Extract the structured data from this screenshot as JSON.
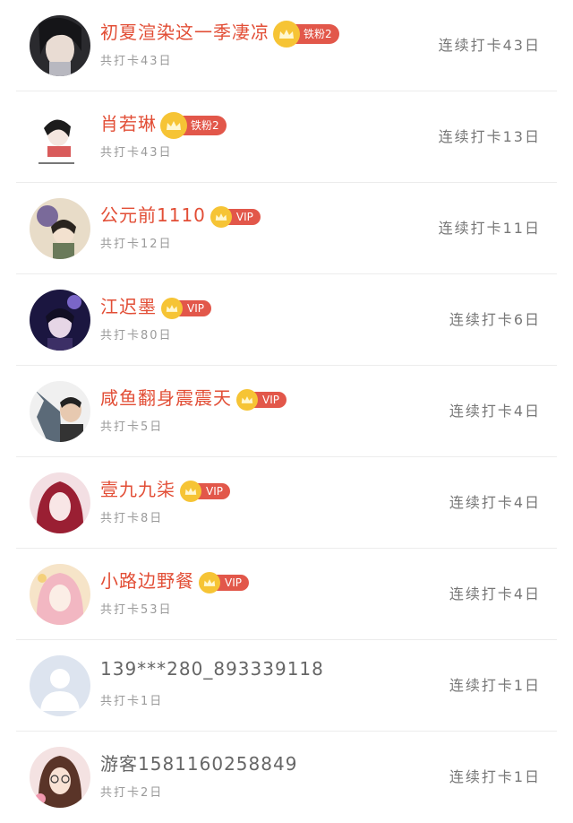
{
  "rows": [
    {
      "name": "初夏渲染这一季凄凉",
      "badge": "铁粉2",
      "badge_type": "fan",
      "total": "共打卡43日",
      "streak": "连续打卡43日"
    },
    {
      "name": "肖若琳",
      "badge": "铁粉2",
      "badge_type": "fan",
      "total": "共打卡43日",
      "streak": "连续打卡13日"
    },
    {
      "name": "公元前1110",
      "badge": "VIP",
      "badge_type": "vip",
      "total": "共打卡12日",
      "streak": "连续打卡11日"
    },
    {
      "name": "江迟墨",
      "badge": "VIP",
      "badge_type": "vip",
      "total": "共打卡80日",
      "streak": "连续打卡6日"
    },
    {
      "name": "咸鱼翻身震震天",
      "badge": "VIP",
      "badge_type": "vip",
      "total": "共打卡5日",
      "streak": "连续打卡4日"
    },
    {
      "name": "壹九九柒",
      "badge": "VIP",
      "badge_type": "vip",
      "total": "共打卡8日",
      "streak": "连续打卡4日"
    },
    {
      "name": "小路边野餐",
      "badge": "VIP",
      "badge_type": "vip",
      "total": "共打卡53日",
      "streak": "连续打卡4日"
    },
    {
      "name": "139***280_893339118",
      "badge": "",
      "badge_type": "none",
      "total": "共打卡1日",
      "streak": "连续打卡1日"
    },
    {
      "name": "游客1581160258849",
      "badge": "",
      "badge_type": "none",
      "total": "共打卡2日",
      "streak": "连续打卡1日"
    }
  ],
  "colors": {
    "accent": "#e24e36",
    "badge": "#e2574a",
    "crown": "#f6c435",
    "divider": "#ececec"
  }
}
